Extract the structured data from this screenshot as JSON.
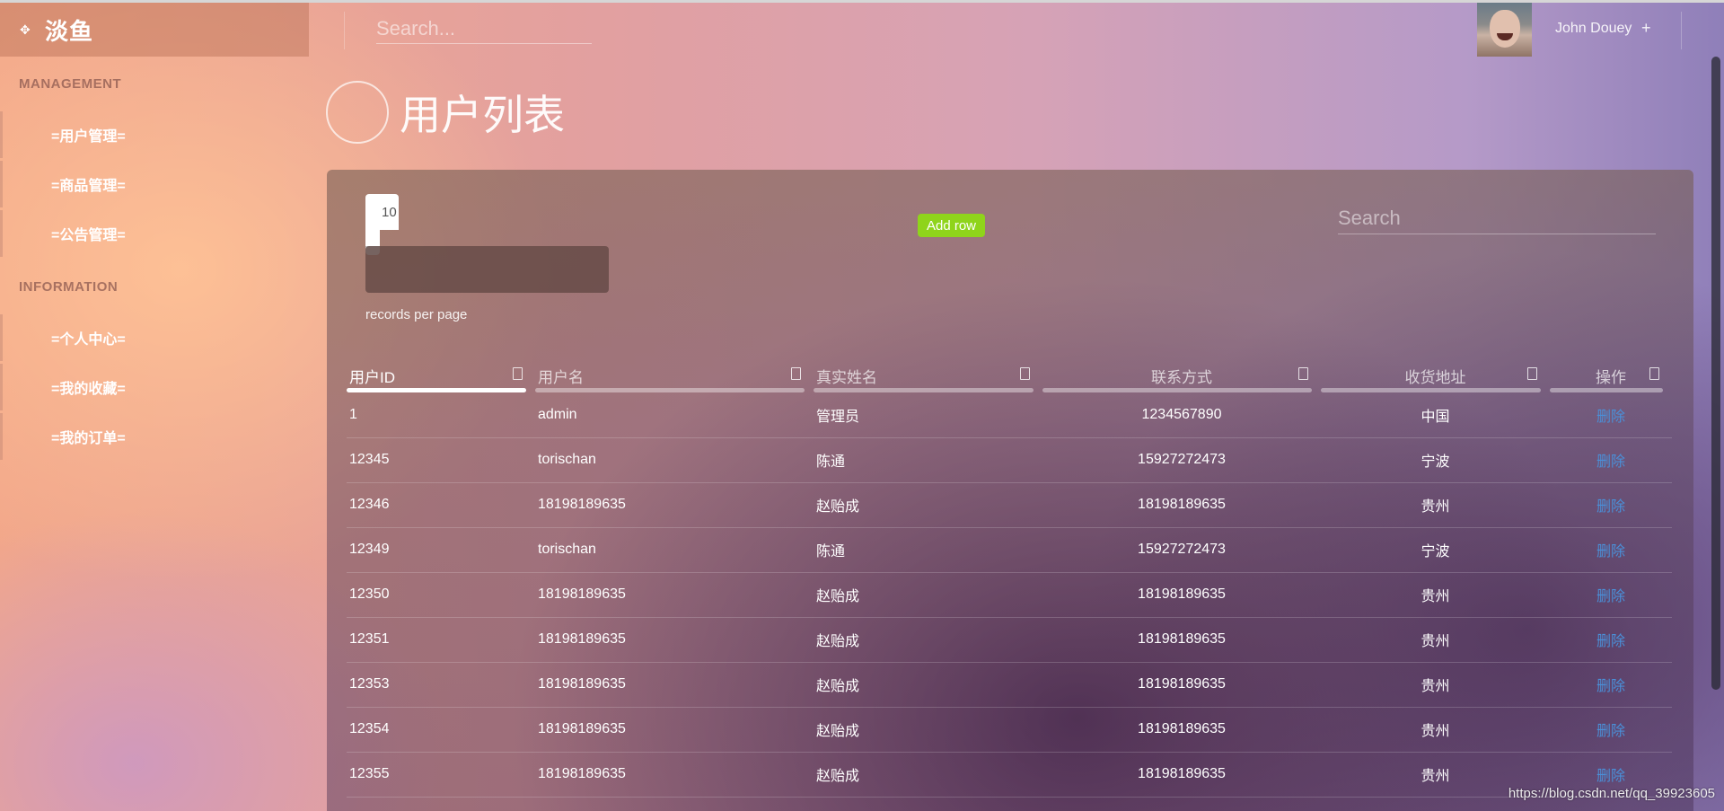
{
  "header": {
    "brand": "淡鱼",
    "search_placeholder": "Search...",
    "user_name": "John Douey",
    "user_menu_glyph": "+"
  },
  "sidebar": {
    "sections": [
      {
        "title": "MANAGEMENT",
        "items": [
          "=用户管理=",
          "=商品管理=",
          "=公告管理="
        ]
      },
      {
        "title": "INFORMATION",
        "items": [
          "=个人中心=",
          "=我的收藏=",
          "=我的订单="
        ]
      }
    ]
  },
  "page": {
    "title": "用户列表"
  },
  "table_controls": {
    "page_length": "10",
    "records_label": "records per page",
    "add_row_label": "Add row",
    "search_placeholder": "Search"
  },
  "table": {
    "columns": [
      "用户ID",
      "用户名",
      "真实姓名",
      "联系方式",
      "收货地址",
      "操作"
    ],
    "rows": [
      [
        "1",
        "admin",
        "管理员",
        "1234567890",
        "中国",
        "删除"
      ],
      [
        "12345",
        "torischan",
        "陈通",
        "15927272473",
        "宁波",
        "删除"
      ],
      [
        "12346",
        "18198189635",
        "赵贻成",
        "18198189635",
        "贵州",
        "删除"
      ],
      [
        "12349",
        "torischan",
        "陈通",
        "15927272473",
        "宁波",
        "删除"
      ],
      [
        "12350",
        "18198189635",
        "赵贻成",
        "18198189635",
        "贵州",
        "删除"
      ],
      [
        "12351",
        "18198189635",
        "赵贻成",
        "18198189635",
        "贵州",
        "删除"
      ],
      [
        "12353",
        "18198189635",
        "赵贻成",
        "18198189635",
        "贵州",
        "删除"
      ],
      [
        "12354",
        "18198189635",
        "赵贻成",
        "18198189635",
        "贵州",
        "删除"
      ],
      [
        "12355",
        "18198189635",
        "赵贻成",
        "18198189635",
        "贵州",
        "删除"
      ]
    ]
  },
  "watermark": "https://blog.csdn.net/qq_39923605",
  "colors": {
    "add_row": "#8fd41b",
    "delete_link": "#4a90d9"
  },
  "icons": {
    "brand": "diamond-arrows-icon",
    "sort": "sort-icon"
  }
}
